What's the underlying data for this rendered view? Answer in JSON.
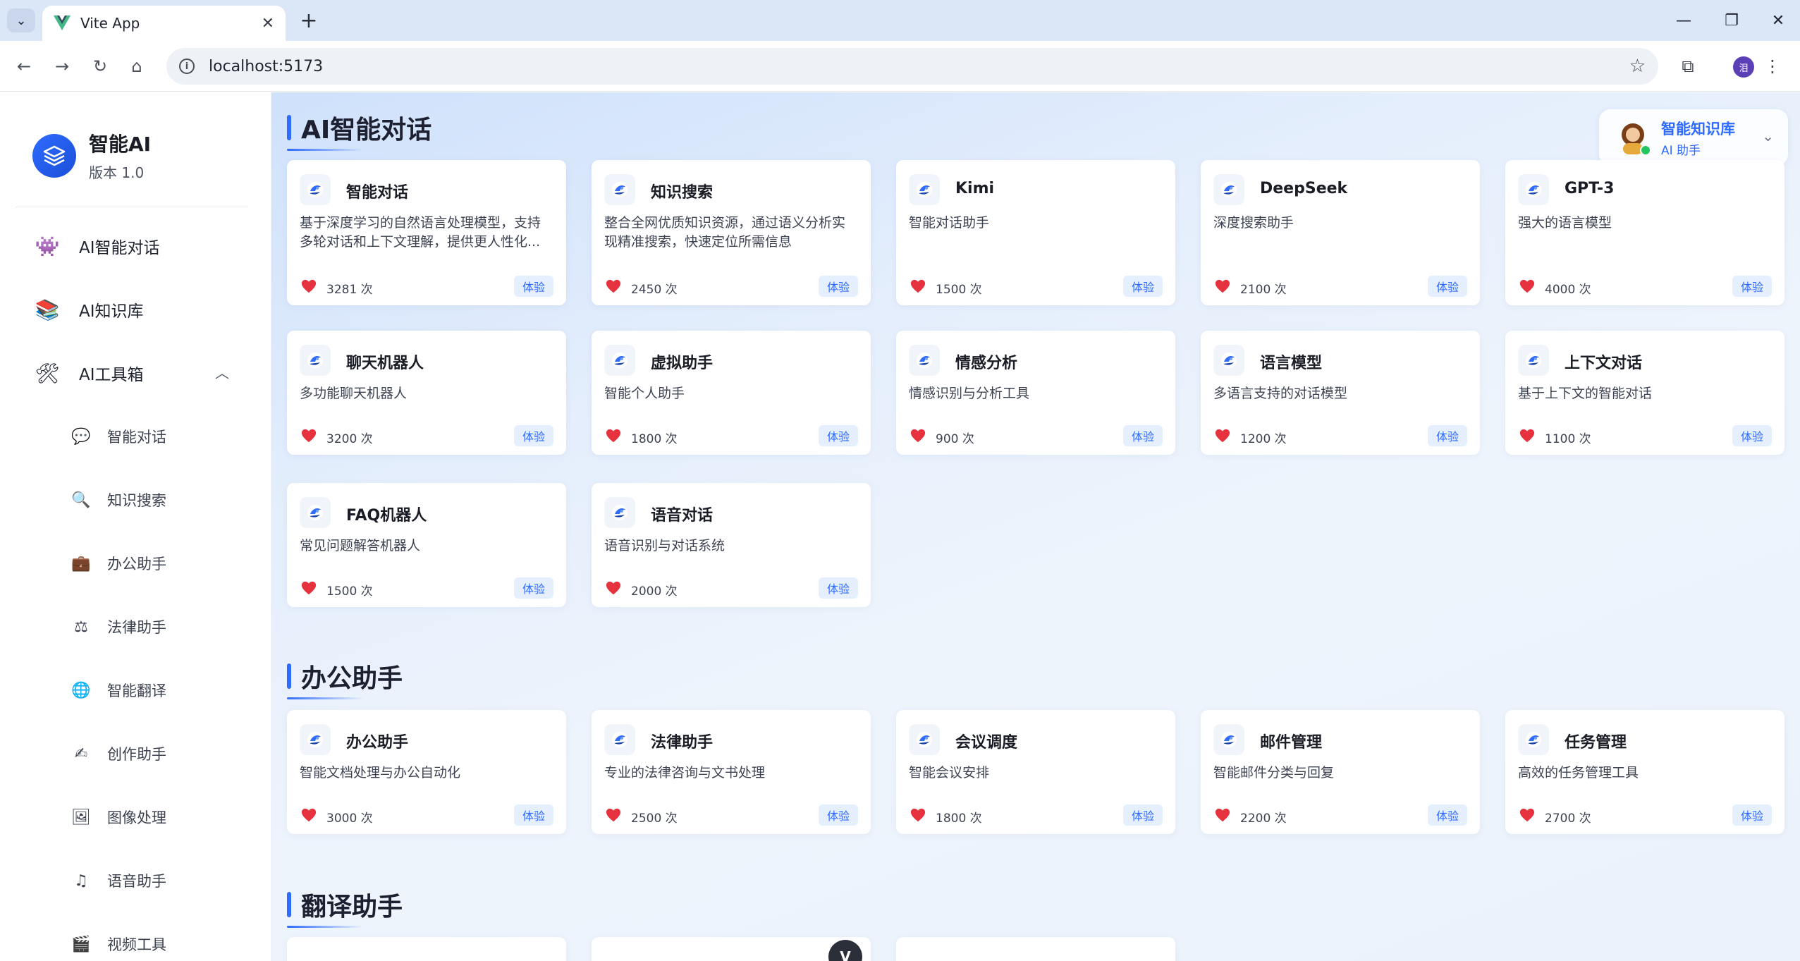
{
  "browser": {
    "tab_title": "Vite App",
    "url": "localhost:5173",
    "profile_initial": "泪"
  },
  "sidebar": {
    "brand_title": "智能AI",
    "brand_version": "版本 1.0",
    "menu": [
      {
        "label": "AI智能对话",
        "icon": "robot-icon"
      },
      {
        "label": "AI知识库",
        "icon": "books-icon"
      },
      {
        "label": "AI工具箱",
        "icon": "tools-icon"
      }
    ],
    "submenu": [
      {
        "label": "智能对话",
        "icon": "speech-bubble-icon"
      },
      {
        "label": "知识搜索",
        "icon": "magnifier-icon"
      },
      {
        "label": "办公助手",
        "icon": "briefcase-icon"
      },
      {
        "label": "法律助手",
        "icon": "scales-icon"
      },
      {
        "label": "智能翻译",
        "icon": "globe-icon"
      },
      {
        "label": "创作助手",
        "icon": "pencil-icon"
      },
      {
        "label": "图像处理",
        "icon": "picture-icon"
      },
      {
        "label": "语音助手",
        "icon": "music-note-icon"
      },
      {
        "label": "视频工具",
        "icon": "clapper-icon"
      }
    ]
  },
  "kb_button": {
    "title": "智能知识库",
    "subtitle": "AI 助手"
  },
  "sections": [
    {
      "title": "AI智能对话",
      "cards": [
        {
          "name": "智能对话",
          "desc": "基于深度学习的自然语言处理模型，支持多轮对话和上下文理解，提供更人性化...",
          "count": "3281 次",
          "action": "体验"
        },
        {
          "name": "知识搜索",
          "desc": "整合全网优质知识资源，通过语义分析实现精准搜索，快速定位所需信息",
          "count": "2450 次",
          "action": "体验"
        },
        {
          "name": "Kimi",
          "desc": "智能对话助手",
          "count": "1500 次",
          "action": "体验"
        },
        {
          "name": "DeepSeek",
          "desc": "深度搜索助手",
          "count": "2100 次",
          "action": "体验"
        },
        {
          "name": "GPT-3",
          "desc": "强大的语言模型",
          "count": "4000 次",
          "action": "体验"
        },
        {
          "name": "聊天机器人",
          "desc": "多功能聊天机器人",
          "count": "3200 次",
          "action": "体验"
        },
        {
          "name": "虚拟助手",
          "desc": "智能个人助手",
          "count": "1800 次",
          "action": "体验"
        },
        {
          "name": "情感分析",
          "desc": "情感识别与分析工具",
          "count": "900 次",
          "action": "体验"
        },
        {
          "name": "语言模型",
          "desc": "多语言支持的对话模型",
          "count": "1200 次",
          "action": "体验"
        },
        {
          "name": "上下文对话",
          "desc": "基于上下文的智能对话",
          "count": "1100 次",
          "action": "体验"
        },
        {
          "name": "FAQ机器人",
          "desc": "常见问题解答机器人",
          "count": "1500 次",
          "action": "体验"
        },
        {
          "name": "语音对话",
          "desc": "语音识别与对话系统",
          "count": "2000 次",
          "action": "体验"
        }
      ]
    },
    {
      "title": "办公助手",
      "cards": [
        {
          "name": "办公助手",
          "desc": "智能文档处理与办公自动化",
          "count": "3000 次",
          "action": "体验"
        },
        {
          "name": "法律助手",
          "desc": "专业的法律咨询与文书处理",
          "count": "2500 次",
          "action": "体验"
        },
        {
          "name": "会议调度",
          "desc": "智能会议安排",
          "count": "1800 次",
          "action": "体验"
        },
        {
          "name": "邮件管理",
          "desc": "智能邮件分类与回复",
          "count": "2200 次",
          "action": "体验"
        },
        {
          "name": "任务管理",
          "desc": "高效的任务管理工具",
          "count": "2700 次",
          "action": "体验"
        }
      ]
    },
    {
      "title": "翻译助手",
      "cards": []
    }
  ],
  "colors": {
    "accent": "#2f6bff",
    "heart": "#e5323e",
    "online": "#22c55e"
  }
}
